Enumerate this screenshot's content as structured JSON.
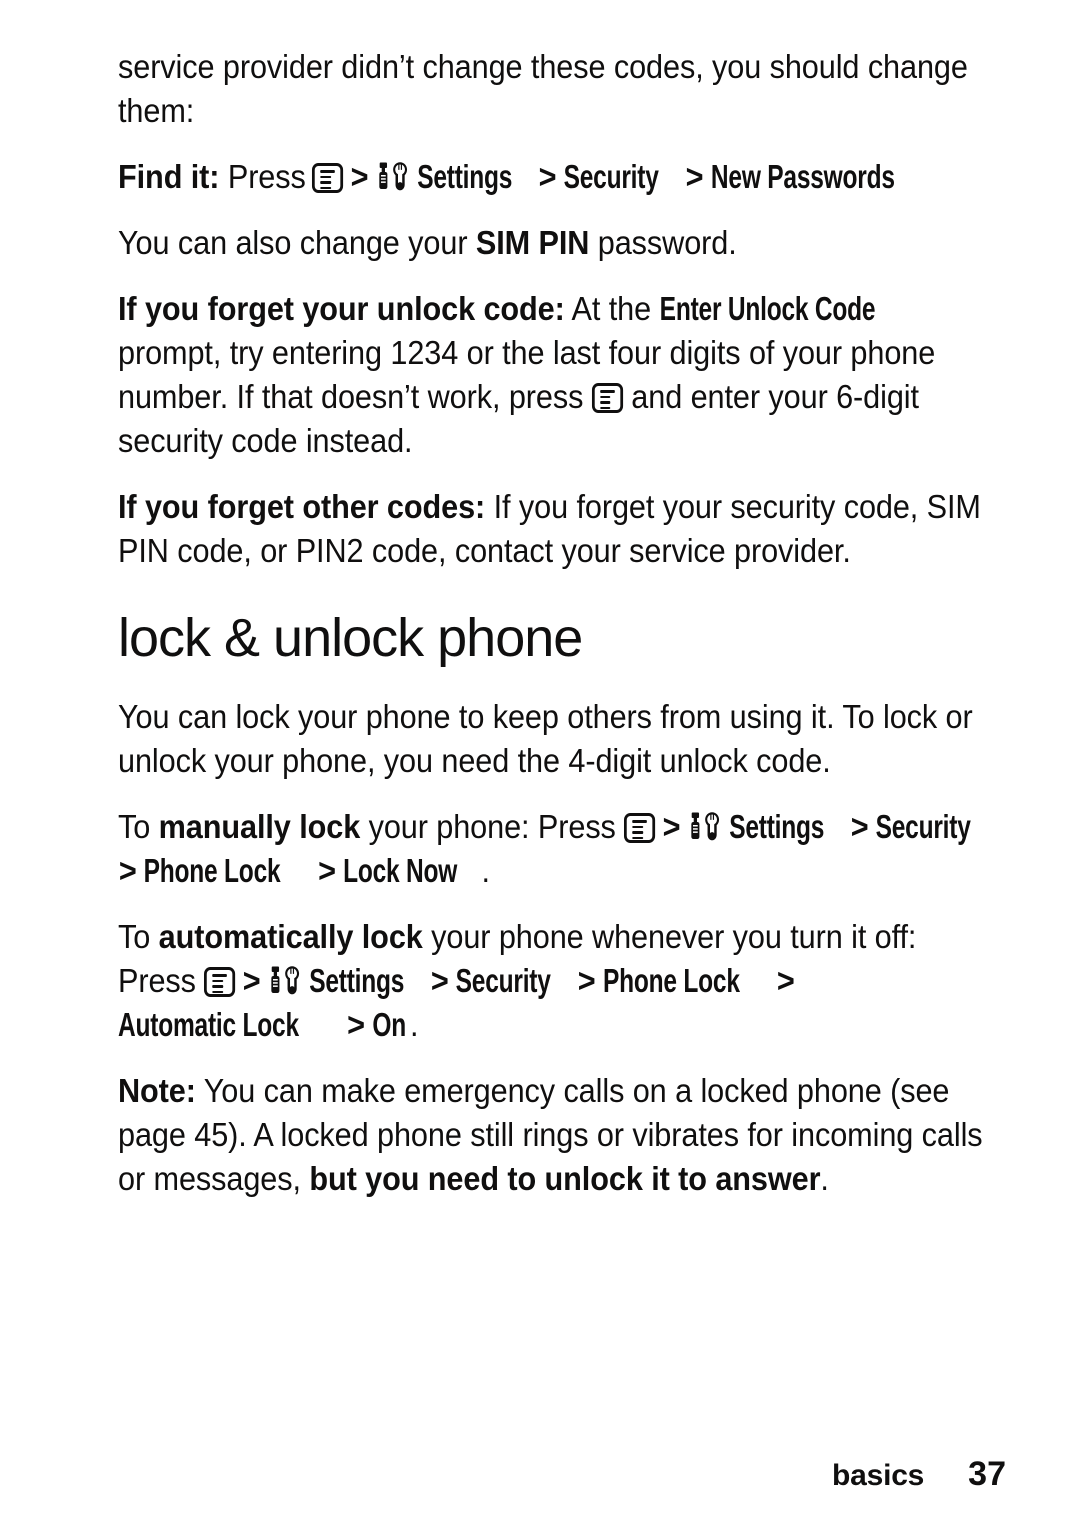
{
  "document": {
    "page_number": "37",
    "section": "basics",
    "heading": "lock & unlock phone"
  },
  "paragraphs": {
    "intro": "service provider didn’t change these codes, you should change them:",
    "find_it_label": "Find it:",
    "find_it_press": "Press",
    "sim_pin_line": {
      "before": "You can also change your ",
      "bold": "SIM PIN",
      "after": " password."
    },
    "forget_unlock": {
      "bold_lead": "If you forget your unlock code:",
      "part1": " At the ",
      "screen_text": "Enter Unlock Code",
      "part2": " prompt, try entering 1234 or the last four digits of your phone number. If that doesn’t work, press ",
      "part3": " and enter your 6-digit security code instead."
    },
    "forget_other": {
      "bold_lead": "If you forget other codes:",
      "rest": " If you forget your security code, SIM PIN code, or PIN2 code, contact your service provider."
    },
    "lock_intro": "You can lock your phone to keep others from using it. To lock or unlock your phone, you need the 4-digit unlock code.",
    "manual_lock": {
      "pre": "To ",
      "bold": "manually lock",
      "post": " your phone: Press "
    },
    "auto_lock": {
      "pre": "To ",
      "bold": "automatically lock",
      "post": " your phone whenever you turn it off:",
      "press": "Press "
    },
    "note": {
      "bold_lead": "Note:",
      "part1": " You can make emergency calls on a locked phone (see page 45). A locked phone still rings or vibrates for incoming calls or messages, ",
      "bold_tail": "but you need to unlock it to answer",
      "period": "."
    }
  },
  "menu_path": {
    "settings": "Settings",
    "security": "Security",
    "new_passwords": "New Passwords",
    "phone_lock": "Phone Lock",
    "lock_now": "Lock Now",
    "automatic_lock": "Automatic Lock",
    "on": "On",
    "separator": ">",
    "trailing_period": "."
  },
  "icons": {
    "menu_key": "menu-key-icon",
    "settings": "settings-tools-icon"
  },
  "colors": {
    "text": "#100f0f",
    "background": "#ffffff"
  }
}
